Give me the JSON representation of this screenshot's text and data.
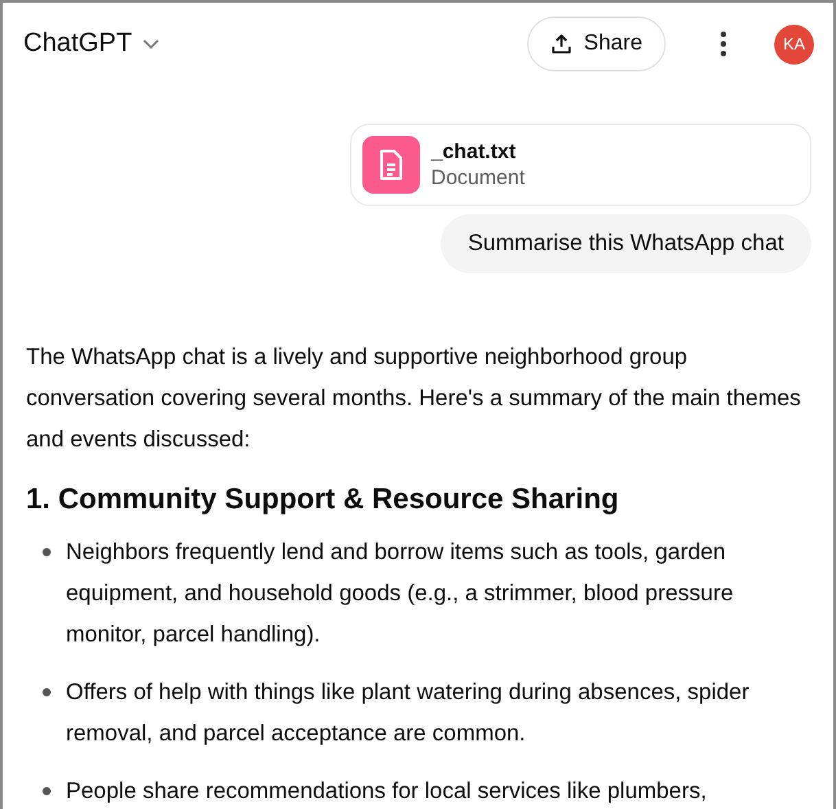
{
  "header": {
    "title": "ChatGPT",
    "share_label": "Share",
    "avatar_initials": "KA"
  },
  "attachment": {
    "name": "_chat.txt",
    "type": "Document"
  },
  "user_message": "Summarise this WhatsApp chat",
  "response": {
    "intro": "The WhatsApp chat is a lively and supportive neighborhood group conversation covering several months. Here's a summary of the main themes and events discussed:",
    "heading": "1. Community Support & Resource Sharing",
    "bullets": [
      "Neighbors frequently lend and borrow items such as tools, garden equipment, and household goods (e.g., a strimmer, blood pressure monitor, parcel handling).",
      "Offers of help with things like plant watering during absences, spider removal, and parcel acceptance are common.",
      "People share recommendations for local services like plumbers,"
    ]
  }
}
